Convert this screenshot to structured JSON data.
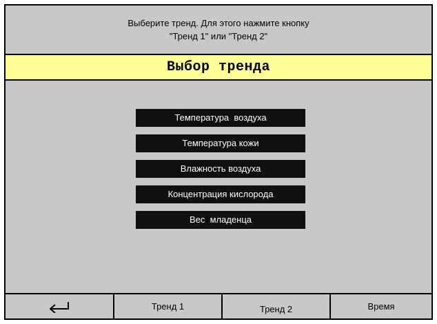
{
  "header": {
    "line1": "Выберите тренд. Для этого нажмите кнопку",
    "line2": "\"Тренд 1\" или \"Тренд 2\""
  },
  "title": "Выбор тренда",
  "options": [
    {
      "label": "Температура  воздуха"
    },
    {
      "label": "Температура кожи"
    },
    {
      "label": "Влажность воздуха"
    },
    {
      "label": "Концентрация кислорода"
    },
    {
      "label": "Вес  младенца"
    }
  ],
  "footer": {
    "back_icon": "enter-arrow-icon",
    "trend1": "Тренд 1",
    "trend2": "Тренд 2",
    "time": "Время"
  },
  "colors": {
    "background": "#c8c8c8",
    "title_bar": "#ffff99",
    "option_button": "#101010"
  }
}
